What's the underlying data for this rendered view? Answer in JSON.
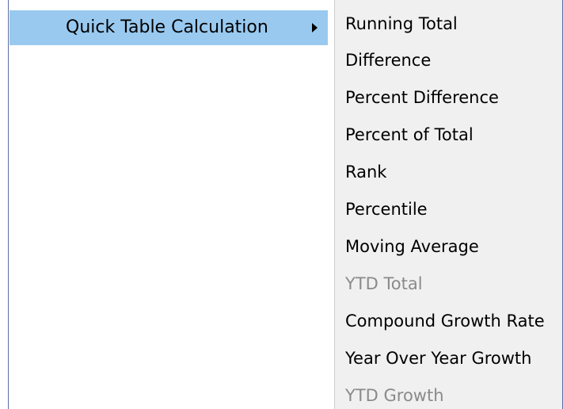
{
  "parent_menu": {
    "highlighted_item": {
      "label": "Quick Table Calculation",
      "icon": "chevron-right-icon"
    }
  },
  "submenu": {
    "items": [
      {
        "label": "Running Total",
        "enabled": true
      },
      {
        "label": "Difference",
        "enabled": true
      },
      {
        "label": "Percent Difference",
        "enabled": true
      },
      {
        "label": "Percent of Total",
        "enabled": true
      },
      {
        "label": "Rank",
        "enabled": true
      },
      {
        "label": "Percentile",
        "enabled": true
      },
      {
        "label": "Moving Average",
        "enabled": true
      },
      {
        "label": "YTD Total",
        "enabled": false
      },
      {
        "label": "Compound Growth Rate",
        "enabled": true
      },
      {
        "label": "Year Over Year Growth",
        "enabled": true
      },
      {
        "label": "YTD Growth",
        "enabled": false
      }
    ]
  },
  "colors": {
    "highlight": "#99c9ef",
    "submenu_background": "#f0f0f0",
    "disabled_text": "#8a8a8a",
    "frame_border": "#5b6fa6"
  }
}
